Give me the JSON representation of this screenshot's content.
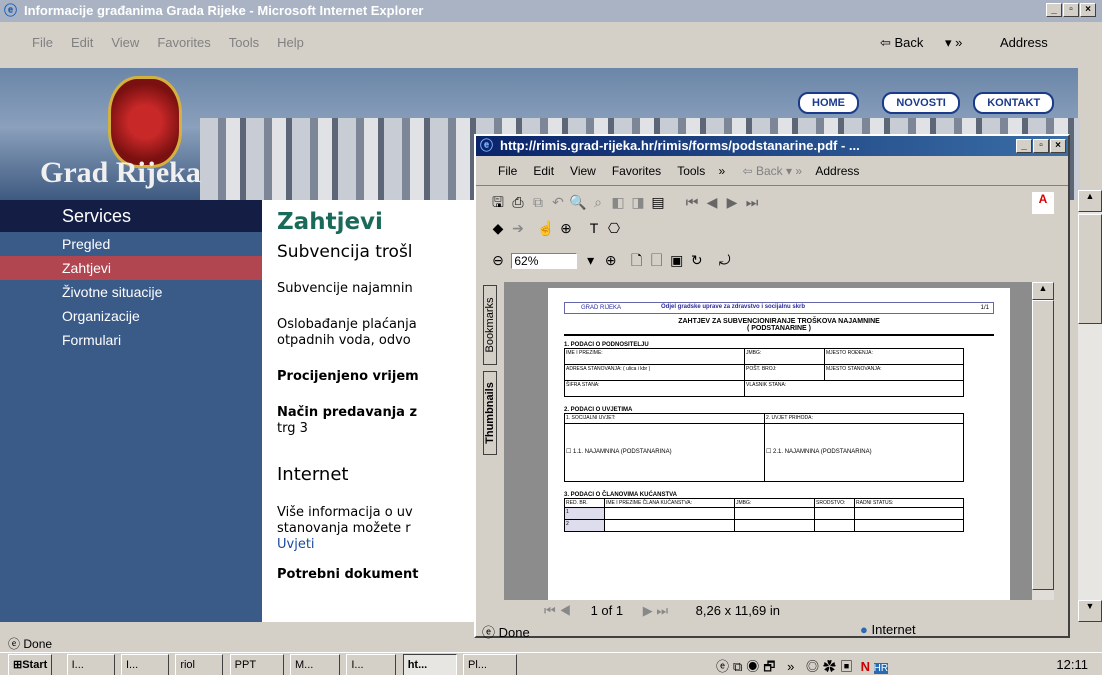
{
  "ie": {
    "title": "Informacije građanima Grada Rijeke - Microsoft Internet Explorer",
    "menu": [
      "File",
      "Edit",
      "View",
      "Favorites",
      "Tools",
      "Help"
    ],
    "back": "Back",
    "address": "Address",
    "status": "Done"
  },
  "site": {
    "brand": "Grad Rijeka",
    "nav": [
      "HOME",
      "NOVOSTI",
      "KONTAKT"
    ],
    "services": "Services",
    "side": [
      "Pregled",
      "Zahtjevi",
      "Životne situacije",
      "Organizacije",
      "Formulari"
    ],
    "heading": "Zahtjevi",
    "sub": "Subvencija trošl",
    "p1": "Subvencije najamnin",
    "p2a": "Oslobađanje plaćanja",
    "p2b": "otpadnih voda, odvo",
    "b1": "Procijenjeno vrijem",
    "b2": "Način predavanja z",
    "trg": "trg 3",
    "h2": "Internet",
    "p3a": "Više informacija o uv",
    "p3b": "stanovanja možete r",
    "link": "Uvjeti",
    "b3": "Potrebni dokument"
  },
  "pdf": {
    "title": "http://rimis.grad-rijeka.hr/rimis/forms/podstanarine.pdf - ...",
    "menu": [
      "File",
      "Edit",
      "View",
      "Favorites",
      "Tools"
    ],
    "back": "Back",
    "address": "Address",
    "zoom": "62%",
    "tabs": [
      "Bookmarks",
      "Thumbnails"
    ],
    "page": "1 of 1",
    "size": "8,26 x 11,69 in",
    "status": "Done",
    "zone": "Internet"
  },
  "doc": {
    "org": "GRAD RIJEKA",
    "dept": "Odjel gradske uprave za zdravstvo i socijalnu skrb",
    "title1": "ZAHTJEV ZA SUBVENCIONIRANJE TROŠKOVA NAJAMNINE",
    "title2": "( PODSTANARINE )",
    "s1": "1. PODACI O PODNOSITELJU",
    "f1": [
      "IME I PREZIME:",
      "JMBG:",
      "MJESTO ROĐENJA:"
    ],
    "f2": [
      "ADRESA STANOVANJA: ( ulica i kbr )",
      "POŠT. BROJ:",
      "MJESTO STANOVANJA:"
    ],
    "f3": [
      "ŠIFRA STANA:",
      "VLASNIK STANA:"
    ],
    "s2": "2. PODACI O UVJETIMA",
    "u1": "1. SOCIJALNI UVJET:",
    "u2": "2. UVJET PRIHODA:",
    "c1": "1.1. NAJAMNINA (PODSTANARINA)",
    "c2": "2.1. NAJAMNINA (PODSTANARINA)",
    "s3": "3. PODACI O ČLANOVIMA KUĆANSTVA",
    "h3": [
      "RED. BR.",
      "IME I PREZIME ČLANA KUĆANSTVA:",
      "JMBG:",
      "SRODSTVO:",
      "RADNI STATUS:"
    ],
    "r": [
      "1",
      "2"
    ],
    "num": "1/1"
  },
  "taskbar": {
    "start": "Start",
    "items": [
      "I...",
      "I...",
      "riol",
      "PPT",
      "M...",
      "I...",
      "ht...",
      "Pl..."
    ],
    "time": "12:11"
  }
}
